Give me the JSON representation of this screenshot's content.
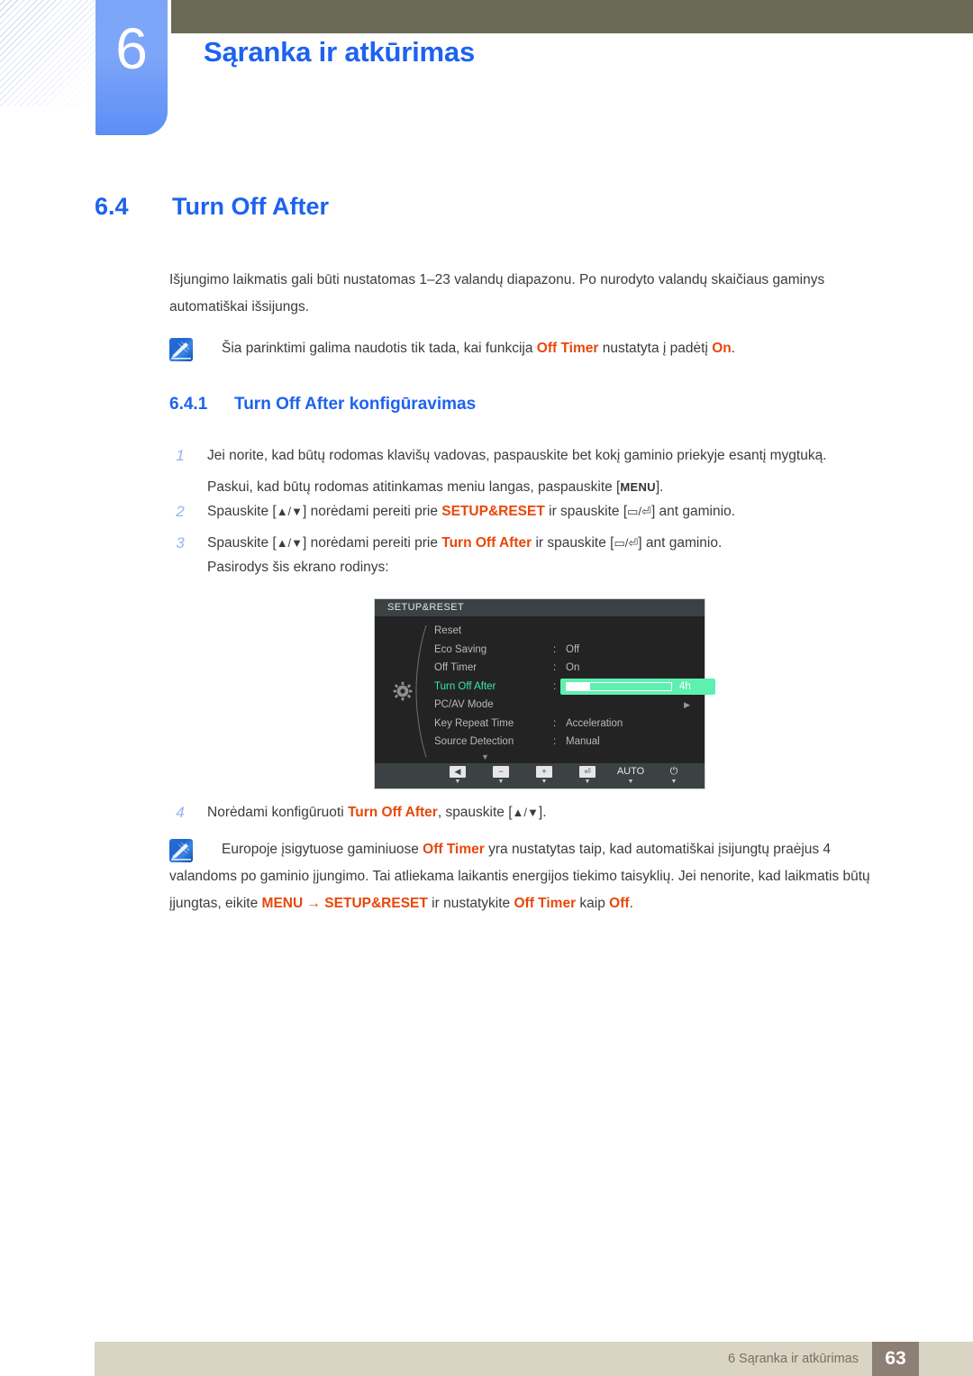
{
  "header": {
    "chapter_number": "6",
    "chapter_title": "Sąranka ir atkūrimas",
    "accent_blue": "#1d62f0",
    "tab_blue": "#6f9bf6",
    "olive": "#6b6a56"
  },
  "section": {
    "number": "6.4",
    "title": "Turn Off After"
  },
  "intro": {
    "text": "Išjungimo laikmatis gali būti nustatomas 1–23 valandų diapazonu. Po nurodyto valandų skaičiaus gaminys automatiškai išsijungs."
  },
  "note1": {
    "icon": "note-pen-icon",
    "part1": "Šia parinktimi galima naudotis tik tada, kai funkcija ",
    "hl1": "Off Timer",
    "part2": " nustatyta į padėtį ",
    "hl2": "On",
    "part3": "."
  },
  "subsection": {
    "number": "6.4.1",
    "title": "Turn Off After konfigūravimas"
  },
  "steps": {
    "step1": {
      "n": "1",
      "line1": "Jei norite, kad būtų rodomas klavišų vadovas, paspauskite bet kokį gaminio priekyje esantį mygtuką.",
      "line2_a": "Paskui, kad būtų rodomas atitinkamas meniu langas, paspauskite [",
      "line2_key": "MENU",
      "line2_b": "]."
    },
    "step2": {
      "n": "2",
      "a": "Spauskite [",
      "updown": "▲/▼",
      "b": "] norėdami pereiti prie ",
      "hl": "SETUP&RESET",
      "c": " ir spauskite [",
      "keys": "▭/⏎",
      "d": "] ant gaminio."
    },
    "step3": {
      "n": "3",
      "a": "Spauskite [",
      "updown": "▲/▼",
      "b": "] norėdami pereiti prie ",
      "hl": "Turn Off After",
      "c": " ir spauskite [",
      "keys": "▭/⏎",
      "d": "] ant gaminio.",
      "follow": "Pasirodys šis ekrano rodinys:"
    },
    "step4": {
      "n": "4",
      "a": "Norėdami konfigūruoti ",
      "hl": "Turn Off After",
      "b": ", spauskite [",
      "updown": "▲/▼",
      "c": "]."
    }
  },
  "osd": {
    "title": "SETUP&RESET",
    "icon": "gear-icon",
    "rows": [
      {
        "label": "Reset",
        "colon": "",
        "value": "",
        "selected": false,
        "type": "plain"
      },
      {
        "label": "Eco Saving",
        "colon": ":",
        "value": "Off",
        "selected": false,
        "type": "plain"
      },
      {
        "label": "Off Timer",
        "colon": ":",
        "value": "On",
        "selected": false,
        "type": "plain"
      },
      {
        "label": "Turn Off After",
        "colon": ":",
        "value": "4h",
        "selected": true,
        "type": "slider",
        "fill_percent": 22
      },
      {
        "label": "PC/AV Mode",
        "colon": "",
        "value": "",
        "selected": false,
        "type": "submenu",
        "chevron": "▶"
      },
      {
        "label": "Key Repeat Time",
        "colon": ":",
        "value": "Acceleration",
        "selected": false,
        "type": "plain"
      },
      {
        "label": "Source Detection",
        "colon": ":",
        "value": "Manual",
        "selected": false,
        "type": "plain"
      }
    ],
    "scroll_down": "▼",
    "footer_buttons": [
      {
        "name": "back-button",
        "glyph": "◀",
        "tick": "▼"
      },
      {
        "name": "minus-button",
        "glyph": "−",
        "tick": "▼"
      },
      {
        "name": "plus-button",
        "glyph": "+",
        "tick": "▼"
      },
      {
        "name": "enter-button",
        "glyph": "⏎",
        "tick": "▼"
      },
      {
        "name": "auto-button",
        "glyph": "AUTO",
        "tick": "▼"
      },
      {
        "name": "power-button",
        "glyph": "⏻",
        "tick": "▼"
      }
    ],
    "highlight_color": "#5ef0b0"
  },
  "note2": {
    "icon": "note-pen-icon",
    "p1": "Europoje įsigytuose gaminiuose ",
    "hl1": "Off Timer",
    "p2": " yra nustatytas taip, kad automatiškai įsijungtų praėjus 4 valandoms po gaminio įjungimo. Tai atliekama laikantis energijos tiekimo taisyklių. Jei nenorite, kad laikmatis būtų įjungtas, eikite ",
    "hl2": "MENU",
    "arrow": " → ",
    "hl3": "SETUP&RESET",
    "p3": " ir nustatykite ",
    "hl4": "Off Timer",
    "p4": " kaip ",
    "hl5": "Off",
    "p5": "."
  },
  "footer": {
    "text": "6 Sąranka ir atkūrimas",
    "page": "63"
  }
}
